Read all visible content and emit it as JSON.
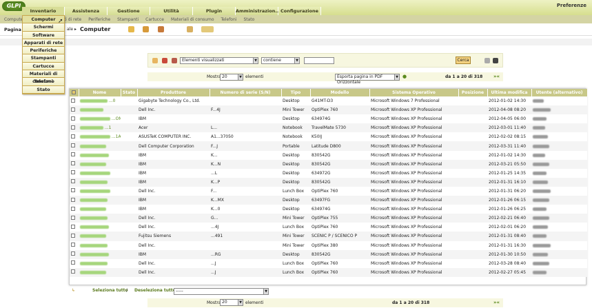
{
  "header": {
    "logo": "GLPI",
    "preferences": "Preferenze"
  },
  "mainmenu": [
    {
      "label": "Inventario",
      "width": 62
    },
    {
      "label": "Assistenza",
      "width": 62
    },
    {
      "label": "Gestione",
      "width": 62
    },
    {
      "label": "Utilità",
      "width": 62
    },
    {
      "label": "Plugin",
      "width": 62
    },
    {
      "label": "Amministrazion...",
      "width": 62
    },
    {
      "label": "Configurazione",
      "width": 62
    }
  ],
  "submenu": [
    "Computer",
    "Schermi",
    "Software",
    "Apparati di rete",
    "Periferiche",
    "Stampanti",
    "Cartucce",
    "Materiali di consumo",
    "Telefoni",
    "Stato"
  ],
  "submenu_visible": [
    "Computer",
    "...are",
    "Apparati di rete",
    "Periferiche",
    "Stampanti",
    "Cartucce",
    "Materiali di consumo",
    "Telefoni",
    "Stato"
  ],
  "crumbs": {
    "page_prefix": "Pagina p",
    "tail": "ale",
    "title": "Computer"
  },
  "dropdown": [
    "Computer",
    "Schermi",
    "Software",
    "Apparati di rete",
    "Periferiche",
    "Stampanti",
    "Cartucce",
    "Materiali di consumo",
    "Telefoni",
    "Stato"
  ],
  "search": {
    "field": "Elementi visualizzati",
    "condition": "contiene",
    "value": "",
    "button": "Cerca"
  },
  "pager": {
    "show_label": "Mostra",
    "per_page": "20",
    "items_label": "elementi",
    "export": "Esporta pagina in PDF Orizzontale",
    "range": "da 1 a 20 di 318"
  },
  "columns": [
    "Nome",
    "Stato",
    "Produttore",
    "Numero di serie (S/N)",
    "Tipo",
    "Modello",
    "Sistema Operativo",
    "Posizione",
    "Ultima modifica",
    "Utente (alternativo)"
  ],
  "rows": [
    {
      "name": "...0",
      "maker": "Gigabyte Technology Co., Ltd.",
      "serial": "",
      "type": "Desktop",
      "model": "G41MT-D3",
      "os": "Microsoft Windows 7 Professional",
      "mod": "2012-01-02 14:30"
    },
    {
      "name": "",
      "maker": "Dell Inc.",
      "serial": "F...4J",
      "type": "Mini Tower",
      "model": "OptiPlex 760",
      "os": "Microsoft Windows XP Professional",
      "mod": "2012-04-08 08:20"
    },
    {
      "name": "...OMB1",
      "maker": "IBM",
      "serial": "",
      "type": "Desktop",
      "model": "634974G",
      "os": "Microsoft Windows XP Professional",
      "mod": "2012-04-05 06:00"
    },
    {
      "name": "...1",
      "maker": "Acer",
      "serial": "L...",
      "type": "Notebook",
      "model": "TravelMate 5730",
      "os": "Microsoft Windows XP Professional",
      "mod": "2012-03-01 11:40"
    },
    {
      "name": "...1A",
      "maker": "ASUSTeK COMPUTER INC.",
      "serial": "A1...37050",
      "type": "Notebook",
      "model": "K50IJ",
      "os": "Microsoft Windows XP Professional",
      "mod": "2012-02-02 08:15"
    },
    {
      "name": "",
      "maker": "Dell Computer Corporation",
      "serial": "F...J",
      "type": "Portable",
      "model": "Latitude D800",
      "os": "Microsoft Windows XP Professional",
      "mod": "2012-03-31 11:40"
    },
    {
      "name": "",
      "maker": "IBM",
      "serial": "K...",
      "type": "Desktop",
      "model": "830542G",
      "os": "Microsoft Windows XP Professional",
      "mod": "2012-01-02 14:30"
    },
    {
      "name": "",
      "maker": "IBM",
      "serial": "K...N",
      "type": "Desktop",
      "model": "830542G",
      "os": "Microsoft Windows XP Professional",
      "mod": "2012-03-21 05:50"
    },
    {
      "name": "",
      "maker": "IBM",
      "serial": "...L",
      "type": "Desktop",
      "model": "634972G",
      "os": "Microsoft Windows XP Professional",
      "mod": "2012-01-25 14:35"
    },
    {
      "name": "",
      "maker": "IBM",
      "serial": "K...P",
      "type": "Desktop",
      "model": "830542G",
      "os": "Microsoft Windows XP Professional",
      "mod": "2012-01-31 16:10"
    },
    {
      "name": "",
      "maker": "Dell Inc.",
      "serial": "F...",
      "type": "Lunch Box",
      "model": "OptiPlex 760",
      "os": "Microsoft Windows XP Professional",
      "mod": "2012-01-31 06:20"
    },
    {
      "name": "",
      "maker": "IBM",
      "serial": "K...MX",
      "type": "Desktop",
      "model": "63497FG",
      "os": "Microsoft Windows XP Professional",
      "mod": "2012-01-26 06:15"
    },
    {
      "name": "",
      "maker": "IBM",
      "serial": "K...0",
      "type": "Desktop",
      "model": "634974G",
      "os": "Microsoft Windows XP Professional",
      "mod": "2012-01-26 06:25"
    },
    {
      "name": "",
      "maker": "Dell Inc.",
      "serial": "G...",
      "type": "Mini Tower",
      "model": "OptiPlex 755",
      "os": "Microsoft Windows XP Professional",
      "mod": "2012-02-21 06:40"
    },
    {
      "name": "",
      "maker": "Dell Inc.",
      "serial": "...4J",
      "type": "Lunch Box",
      "model": "OptiPlex 760",
      "os": "Microsoft Windows XP Professional",
      "mod": "2012-02-01 06:20"
    },
    {
      "name": "",
      "maker": "Fujitsu Siemens",
      "serial": "...491",
      "type": "Mini Tower",
      "model": "SCENIC P / SCENICO P",
      "os": "Microsoft Windows XP Professional",
      "mod": "2012-01-31 08:40"
    },
    {
      "name": "",
      "maker": "Dell Inc.",
      "serial": "",
      "type": "Mini Tower",
      "model": "OptiPlex 380",
      "os": "Microsoft Windows XP Professional",
      "mod": "2012-01-31 16:30"
    },
    {
      "name": "",
      "maker": "IBM",
      "serial": "...RG",
      "type": "Desktop",
      "model": "830542G",
      "os": "Microsoft Windows XP Professional",
      "mod": "2012-01-30 10:50"
    },
    {
      "name": "",
      "maker": "Dell Inc.",
      "serial": "...J",
      "type": "Lunch Box",
      "model": "OptiPlex 760",
      "os": "Microsoft Windows XP Professional",
      "mod": "2012-03-28 08:40"
    },
    {
      "name": "",
      "maker": "Dell Inc.",
      "serial": "...J",
      "type": "Lunch Box",
      "model": "OptiPlex 760",
      "os": "Microsoft Windows XP Professional",
      "mod": "2012-02-27 05:45"
    }
  ],
  "bottom": {
    "select_all": "Seleziona tutto",
    "sep": "/",
    "deselect_all": "Deseleziona tutto",
    "action": "-----"
  }
}
